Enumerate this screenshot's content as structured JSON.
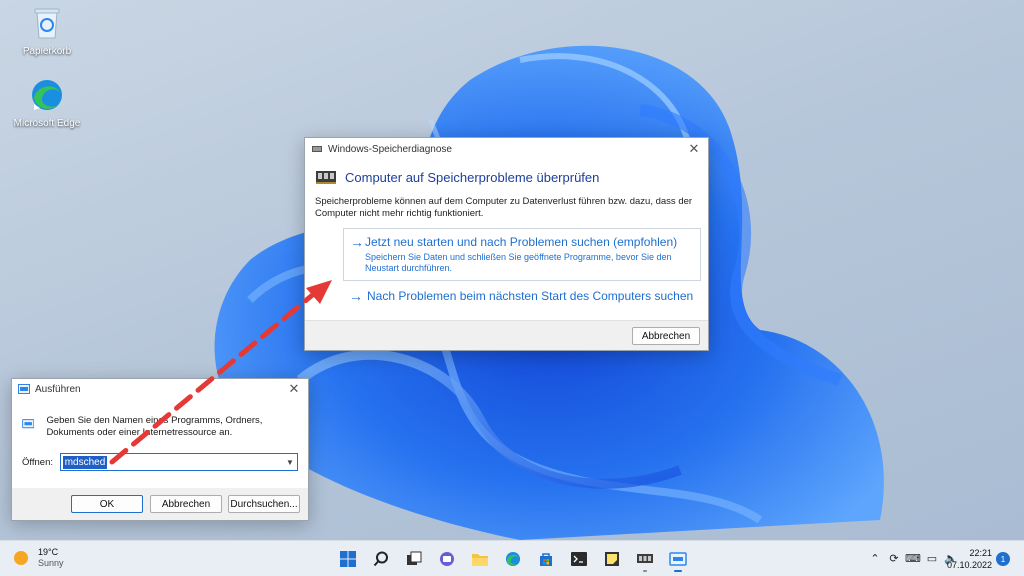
{
  "desktop": {
    "icons": [
      {
        "label": "Papierkorb",
        "icon": "recycle-bin-icon"
      },
      {
        "label": "Microsoft Edge",
        "icon": "edge-icon"
      }
    ]
  },
  "memdiag": {
    "title": "Windows-Speicherdiagnose",
    "heading": "Computer auf Speicherprobleme überprüfen",
    "description": "Speicherprobleme können auf dem Computer zu Datenverlust führen bzw. dazu, dass der Computer nicht mehr richtig funktioniert.",
    "option1": {
      "title": "Jetzt neu starten und nach Problemen suchen (empfohlen)",
      "subtitle": "Speichern Sie Daten und schließen Sie geöffnete Programme, bevor Sie den Neustart durchführen."
    },
    "option2": {
      "title": "Nach Problemen beim nächsten Start des Computers suchen"
    },
    "cancel_label": "Abbrechen",
    "arrow_glyph": "→",
    "close_glyph": "✕"
  },
  "run": {
    "title": "Ausführen",
    "intro": "Geben Sie den Namen eines Programms, Ordners, Dokuments oder einer Internetressource an.",
    "open_label": "Öffnen:",
    "open_value": "mdsched",
    "ok_label": "OK",
    "cancel_label": "Abbrechen",
    "browse_label": "Durchsuchen...",
    "close_glyph": "✕"
  },
  "taskbar": {
    "weather": {
      "temp": "19°C",
      "condition": "Sunny"
    },
    "apps": [
      "start-icon",
      "search-icon",
      "task-view-icon",
      "chat-icon",
      "file-explorer-icon",
      "edge-icon",
      "store-icon",
      "terminal-icon",
      "sticky-notes-icon",
      "memory-diagnostic-icon",
      "run-icon"
    ],
    "clock": {
      "time": "22:21",
      "date": "07.10.2022"
    },
    "notification_count": "1"
  },
  "colors": {
    "accent": "#1f6fd1",
    "link": "#1f6fd1",
    "heading": "#1e3f9a",
    "annotation": "#e53935"
  }
}
